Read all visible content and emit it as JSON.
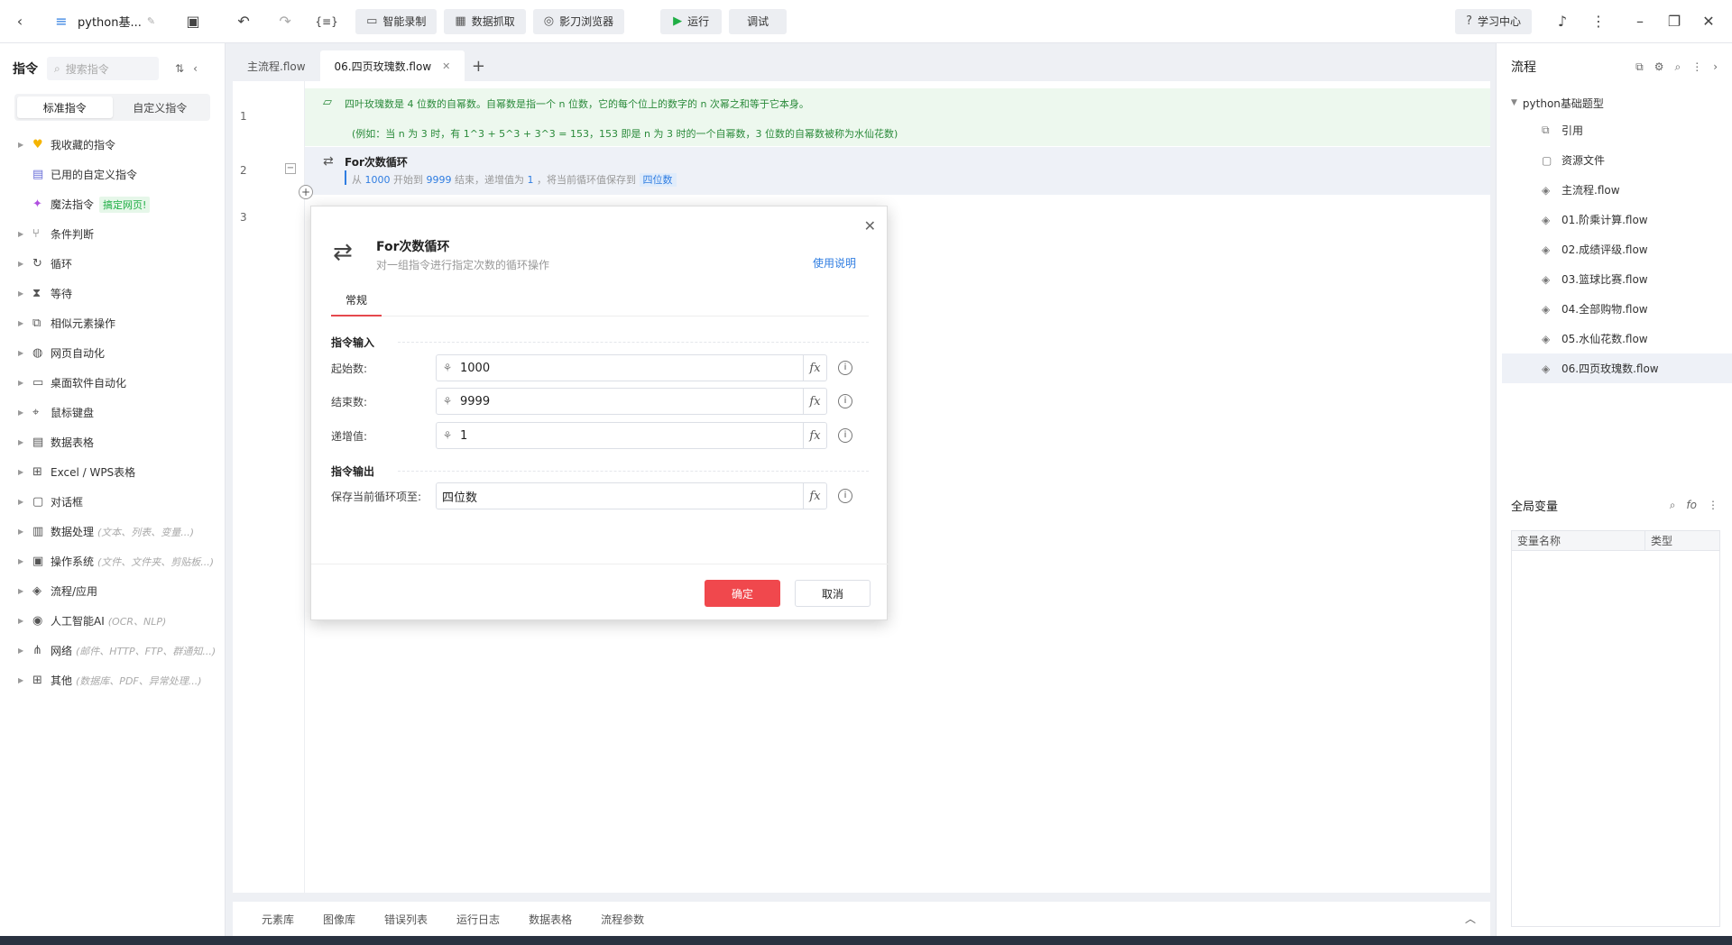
{
  "topbar": {
    "project_name": "python基...",
    "buttons": [
      {
        "label": "智能录制",
        "icon": "video-icon"
      },
      {
        "label": "数据抓取",
        "icon": "table-icon"
      },
      {
        "label": "影刀浏览器",
        "icon": "browser-icon"
      }
    ],
    "run_label": "运行",
    "debug_label": "调试",
    "learn_label": "学习中心"
  },
  "left": {
    "title": "指令",
    "search_placeholder": "搜索指令",
    "tabs": [
      "标准指令",
      "自定义指令"
    ],
    "items": [
      {
        "label": "我收藏的指令",
        "icon": "heart-icon",
        "hint": ""
      },
      {
        "label": "已用的自定义指令",
        "icon": "custom-icon",
        "hint": ""
      },
      {
        "label": "魔法指令",
        "icon": "magic-icon",
        "hint": "",
        "badge": "搞定网页!"
      },
      {
        "label": "条件判断",
        "icon": "branch-icon",
        "hint": ""
      },
      {
        "label": "循环",
        "icon": "loop-icon",
        "hint": ""
      },
      {
        "label": "等待",
        "icon": "hourglass-icon",
        "hint": ""
      },
      {
        "label": "相似元素操作",
        "icon": "copy-icon",
        "hint": ""
      },
      {
        "label": "网页自动化",
        "icon": "globe-icon",
        "hint": ""
      },
      {
        "label": "桌面软件自动化",
        "icon": "monitor-icon",
        "hint": ""
      },
      {
        "label": "鼠标键盘",
        "icon": "mouse-icon",
        "hint": ""
      },
      {
        "label": "数据表格",
        "icon": "sheet-icon",
        "hint": ""
      },
      {
        "label": "Excel / WPS表格",
        "icon": "excel-icon",
        "hint": ""
      },
      {
        "label": "对话框",
        "icon": "dialog-icon",
        "hint": ""
      },
      {
        "label": "数据处理",
        "icon": "data-icon",
        "hint": "(文本、列表、变量...)"
      },
      {
        "label": "操作系统",
        "icon": "os-icon",
        "hint": "(文件、文件夹、剪贴板...)"
      },
      {
        "label": "流程/应用",
        "icon": "layers-icon",
        "hint": ""
      },
      {
        "label": "人工智能AI",
        "icon": "ai-icon",
        "hint": "(OCR、NLP)"
      },
      {
        "label": "网络",
        "icon": "network-icon",
        "hint": "(邮件、HTTP、FTP、群通知...)"
      },
      {
        "label": "其他",
        "icon": "grid-icon",
        "hint": "(数据库、PDF、异常处理...)"
      }
    ]
  },
  "editor": {
    "tabs": [
      {
        "label": "主流程.flow",
        "active": false
      },
      {
        "label": "06.四页玫瑰数.flow",
        "active": true
      }
    ],
    "line_numbers": [
      "1",
      "2",
      "3"
    ],
    "note_line1": "四叶玫瑰数是 4 位数的自幂数。自幂数是指一个 n 位数，它的每个位上的数字的 n 次幂之和等于它本身。",
    "note_line2": "(例如：当 n 为 3 时，有 1^3 + 5^3 + 3^3 = 153，153 即是 n 为 3 时的一个自幂数，3 位数的自幂数被称为水仙花数)",
    "loop_title": "For次数循环",
    "loop_desc": {
      "p1": "从",
      "start": "1000",
      "p2": "开始到",
      "end": "9999",
      "p3": "结束，递增值为",
      "step": "1",
      "p4": "，将当前循环值保存到",
      "var": "四位数"
    }
  },
  "bottom_tabs": [
    "元素库",
    "图像库",
    "错误列表",
    "运行日志",
    "数据表格",
    "流程参数"
  ],
  "right": {
    "title": "流程",
    "root": "python基础题型",
    "items": [
      {
        "label": "引用",
        "icon": "reference-icon"
      },
      {
        "label": "资源文件",
        "icon": "resource-icon"
      },
      {
        "label": "主流程.flow",
        "icon": "flow-icon"
      },
      {
        "label": "01.阶乘计算.flow",
        "icon": "flow-icon"
      },
      {
        "label": "02.成绩评级.flow",
        "icon": "flow-icon"
      },
      {
        "label": "03.篮球比赛.flow",
        "icon": "flow-icon"
      },
      {
        "label": "04.全部购物.flow",
        "icon": "flow-icon"
      },
      {
        "label": "05.水仙花数.flow",
        "icon": "flow-icon"
      },
      {
        "label": "06.四页玫瑰数.flow",
        "icon": "flow-icon",
        "selected": true
      }
    ],
    "globals_title": "全局变量",
    "globals_columns": [
      "变量名称",
      "类型"
    ]
  },
  "dialog": {
    "title": "For次数循环",
    "subtitle": "对一组指令进行指定次数的循环操作",
    "help_link": "使用说明",
    "tab": "常规",
    "input_section": "指令输入",
    "output_section": "指令输出",
    "fields": [
      {
        "label": "起始数:",
        "value": "1000"
      },
      {
        "label": "结束数:",
        "value": "9999"
      },
      {
        "label": "递增值:",
        "value": "1"
      }
    ],
    "output_field": {
      "label": "保存当前循环项至:",
      "value": "四位数"
    },
    "ok_label": "确定",
    "cancel_label": "取消"
  },
  "colors": {
    "accent_red": "#f0484d",
    "link_blue": "#2f7de1",
    "note_green": "#2a8a3a"
  }
}
